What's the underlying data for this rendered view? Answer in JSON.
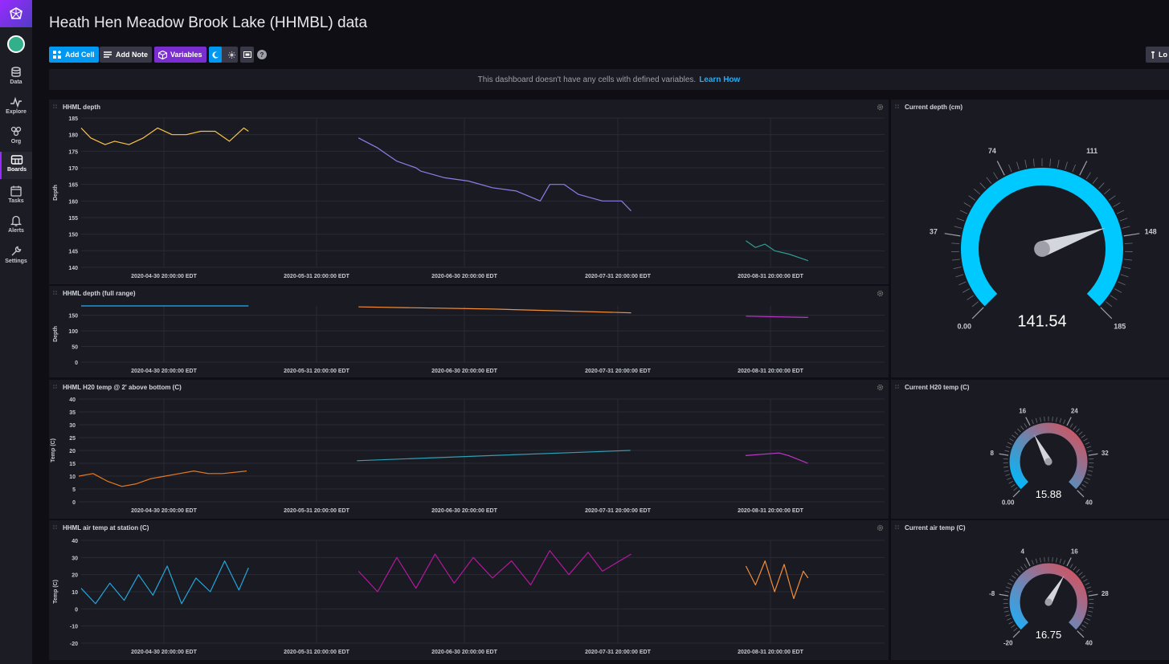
{
  "nav": {
    "logo_icon": "influxdb-logo-icon",
    "items": [
      {
        "label": "Data",
        "icon": "database-icon"
      },
      {
        "label": "Explore",
        "icon": "graph-icon"
      },
      {
        "label": "Org",
        "icon": "users-icon"
      },
      {
        "label": "Boards",
        "icon": "dashboard-icon"
      },
      {
        "label": "Tasks",
        "icon": "calendar-icon"
      },
      {
        "label": "Alerts",
        "icon": "bell-icon"
      },
      {
        "label": "Settings",
        "icon": "wrench-icon"
      }
    ],
    "active": "Boards"
  },
  "header": {
    "title": "Heath Hen Meadow Brook Lake (HHMBL) data",
    "add_cell": "Add Cell",
    "add_note": "Add Note",
    "variables": "Variables",
    "right_button": "Lo"
  },
  "banner": {
    "text": "This dashboard doesn't have any cells with defined variables.",
    "link": "Learn How"
  },
  "colors": {
    "accent_blue": "#0098f0",
    "variables_purple": "#7a2ecf",
    "gauge_cyan": "#00c9ff",
    "gauge_blue": "#22adf6",
    "gauge_red": "#dc4e58"
  },
  "cells": {
    "depth": {
      "title": "HHML depth",
      "y_label": "Depth"
    },
    "depth_full": {
      "title": "HHML depth (full range)",
      "y_label": "Depth"
    },
    "h2o": {
      "title": "HHML H20 temp @ 2' above bottom (C)",
      "y_label": "Temp (C)"
    },
    "air": {
      "title": "HHML air temp at station (C)",
      "y_label": "Temp (C)"
    },
    "g_depth": {
      "title": "Current depth (cm)"
    },
    "g_h2o": {
      "title": "Current H20 temp (C)"
    },
    "g_air": {
      "title": "Current air temp (C)"
    }
  },
  "chart_data": [
    {
      "type": "line",
      "title": "HHML depth",
      "ylabel": "Depth",
      "ylim": [
        140,
        185
      ],
      "y_ticks": [
        185,
        180,
        175,
        170,
        165,
        160,
        155,
        150,
        145,
        140
      ],
      "x_ticks": [
        "2020-04-30 20:00:00 EDT",
        "2020-05-31 20:00:00 EDT",
        "2020-06-30 20:00:00 EDT",
        "2020-07-31 20:00:00 EDT",
        "2020-08-31 20:00:00 EDT"
      ],
      "x_range": [
        "2020-04-15",
        "2020-09-30"
      ],
      "series": [
        {
          "color": "#f7c344",
          "x": [
            "2020-04-15",
            "2020-04-17",
            "2020-04-20",
            "2020-04-22",
            "2020-04-25",
            "2020-04-28",
            "2020-05-01",
            "2020-05-04",
            "2020-05-07",
            "2020-05-10",
            "2020-05-13",
            "2020-05-16",
            "2020-05-19",
            "2020-05-20"
          ],
          "y": [
            182,
            179,
            177,
            178,
            177,
            179,
            182,
            180,
            180,
            181,
            181,
            178,
            182,
            181
          ]
        },
        {
          "color": "#8b7fe8",
          "x": [
            "2020-06-12",
            "2020-06-16",
            "2020-06-20",
            "2020-06-24",
            "2020-06-25",
            "2020-06-30",
            "2020-07-05",
            "2020-07-10",
            "2020-07-15",
            "2020-07-20",
            "2020-07-22",
            "2020-07-25",
            "2020-07-28",
            "2020-08-02",
            "2020-08-06",
            "2020-08-08"
          ],
          "y": [
            179,
            176,
            172,
            170,
            169,
            167,
            166,
            164,
            163,
            160,
            165,
            165,
            162,
            160,
            160,
            157
          ]
        },
        {
          "color": "#2e9c91",
          "x": [
            "2020-09-01",
            "2020-09-03",
            "2020-09-05",
            "2020-09-07",
            "2020-09-10",
            "2020-09-14"
          ],
          "y": [
            148,
            146,
            147,
            145,
            144,
            142
          ]
        }
      ]
    },
    {
      "type": "line",
      "title": "HHML depth (full range)",
      "ylabel": "Depth",
      "ylim": [
        0,
        180
      ],
      "y_ticks": [
        150,
        100,
        50,
        0
      ],
      "x_ticks": [
        "2020-04-30 20:00:00 EDT",
        "2020-05-31 20:00:00 EDT",
        "2020-06-30 20:00:00 EDT",
        "2020-07-31 20:00:00 EDT",
        "2020-08-31 20:00:00 EDT"
      ],
      "x_range": [
        "2020-04-15",
        "2020-09-30"
      ],
      "series": [
        {
          "color": "#22adf6",
          "x": [
            "2020-04-15",
            "2020-05-20"
          ],
          "y": [
            180,
            180
          ]
        },
        {
          "color": "#f48d38",
          "x": [
            "2020-06-12",
            "2020-07-10",
            "2020-08-08"
          ],
          "y": [
            177,
            170,
            158
          ]
        },
        {
          "color": "#bc38c9",
          "x": [
            "2020-09-01",
            "2020-09-14"
          ],
          "y": [
            147,
            143
          ]
        }
      ]
    },
    {
      "type": "line",
      "title": "HHML H20 temp @ 2' above bottom (C)",
      "ylabel": "Temp (C)",
      "ylim": [
        0,
        40
      ],
      "y_ticks": [
        40,
        35,
        30,
        25,
        20,
        15,
        10,
        5,
        0
      ],
      "x_ticks": [
        "2020-04-30 20:00:00 EDT",
        "2020-05-31 20:00:00 EDT",
        "2020-06-30 20:00:00 EDT",
        "2020-07-31 20:00:00 EDT",
        "2020-08-31 20:00:00 EDT"
      ],
      "x_range": [
        "2020-04-15",
        "2020-09-30"
      ],
      "series": [
        {
          "color": "#e8791f",
          "x": [
            "2020-04-15",
            "2020-04-18",
            "2020-04-21",
            "2020-04-24",
            "2020-04-27",
            "2020-04-30",
            "2020-05-03",
            "2020-05-06",
            "2020-05-09",
            "2020-05-12",
            "2020-05-15",
            "2020-05-20"
          ],
          "y": [
            10,
            11,
            8,
            6,
            7,
            9,
            10,
            11,
            12,
            11,
            11,
            12
          ]
        },
        {
          "color": "#2ea0b4",
          "x": [
            "2020-06-12",
            "2020-07-10",
            "2020-08-08"
          ],
          "y": [
            16,
            18,
            20
          ]
        },
        {
          "color": "#bc38c9",
          "x": [
            "2020-09-01",
            "2020-09-08",
            "2020-09-10",
            "2020-09-14"
          ],
          "y": [
            18,
            19,
            18,
            15
          ]
        }
      ]
    },
    {
      "type": "line",
      "title": "HHML air temp at station (C)",
      "ylabel": "Temp (C)",
      "ylim": [
        -20,
        40
      ],
      "y_ticks": [
        40,
        30,
        20,
        10,
        0,
        -10,
        -20
      ],
      "x_ticks": [
        "2020-04-30 20:00:00 EDT",
        "2020-05-31 20:00:00 EDT",
        "2020-06-30 20:00:00 EDT",
        "2020-07-31 20:00:00 EDT",
        "2020-08-31 20:00:00 EDT"
      ],
      "x_range": [
        "2020-04-15",
        "2020-09-30"
      ],
      "series": [
        {
          "color": "#22a6dc",
          "x": [
            "2020-04-15",
            "2020-04-18",
            "2020-04-21",
            "2020-04-24",
            "2020-04-27",
            "2020-04-30",
            "2020-05-03",
            "2020-05-06",
            "2020-05-09",
            "2020-05-12",
            "2020-05-15",
            "2020-05-18",
            "2020-05-20"
          ],
          "y": [
            12,
            3,
            15,
            5,
            20,
            8,
            25,
            3,
            18,
            10,
            28,
            11,
            24
          ]
        },
        {
          "color": "#b3199e",
          "x": [
            "2020-06-12",
            "2020-06-16",
            "2020-06-20",
            "2020-06-24",
            "2020-06-28",
            "2020-07-02",
            "2020-07-06",
            "2020-07-10",
            "2020-07-14",
            "2020-07-18",
            "2020-07-22",
            "2020-07-26",
            "2020-07-30",
            "2020-08-02",
            "2020-08-08"
          ],
          "y": [
            22,
            10,
            30,
            12,
            32,
            15,
            30,
            18,
            28,
            14,
            34,
            20,
            33,
            22,
            32
          ]
        },
        {
          "color": "#f48d38",
          "x": [
            "2020-09-01",
            "2020-09-03",
            "2020-09-05",
            "2020-09-07",
            "2020-09-09",
            "2020-09-11",
            "2020-09-13",
            "2020-09-14"
          ],
          "y": [
            25,
            14,
            28,
            10,
            26,
            6,
            22,
            18
          ]
        }
      ]
    }
  ],
  "gauges": [
    {
      "title": "Current depth (cm)",
      "value": "141.54",
      "min_label": "0.00",
      "ticks": [
        "37",
        "74",
        "111",
        "148",
        "185"
      ],
      "min": 0,
      "max": 185,
      "val": 141.54,
      "colors": [
        "#00c9ff",
        "#00c9ff"
      ]
    },
    {
      "title": "Current H20 temp (C)",
      "value": "15.88",
      "min_label": "0.00",
      "ticks": [
        "8",
        "16",
        "24",
        "32",
        "40"
      ],
      "min": 0,
      "max": 40,
      "val": 15.88,
      "colors": [
        "#00b9ff",
        "#dc4e58"
      ]
    },
    {
      "title": "Current air temp (C)",
      "value": "16.75",
      "min_label": "-20",
      "ticks": [
        "-8",
        "4",
        "16",
        "28",
        "40"
      ],
      "min": -20,
      "max": 40,
      "val": 16.75,
      "colors": [
        "#22adf6",
        "#dc4e58"
      ]
    }
  ]
}
